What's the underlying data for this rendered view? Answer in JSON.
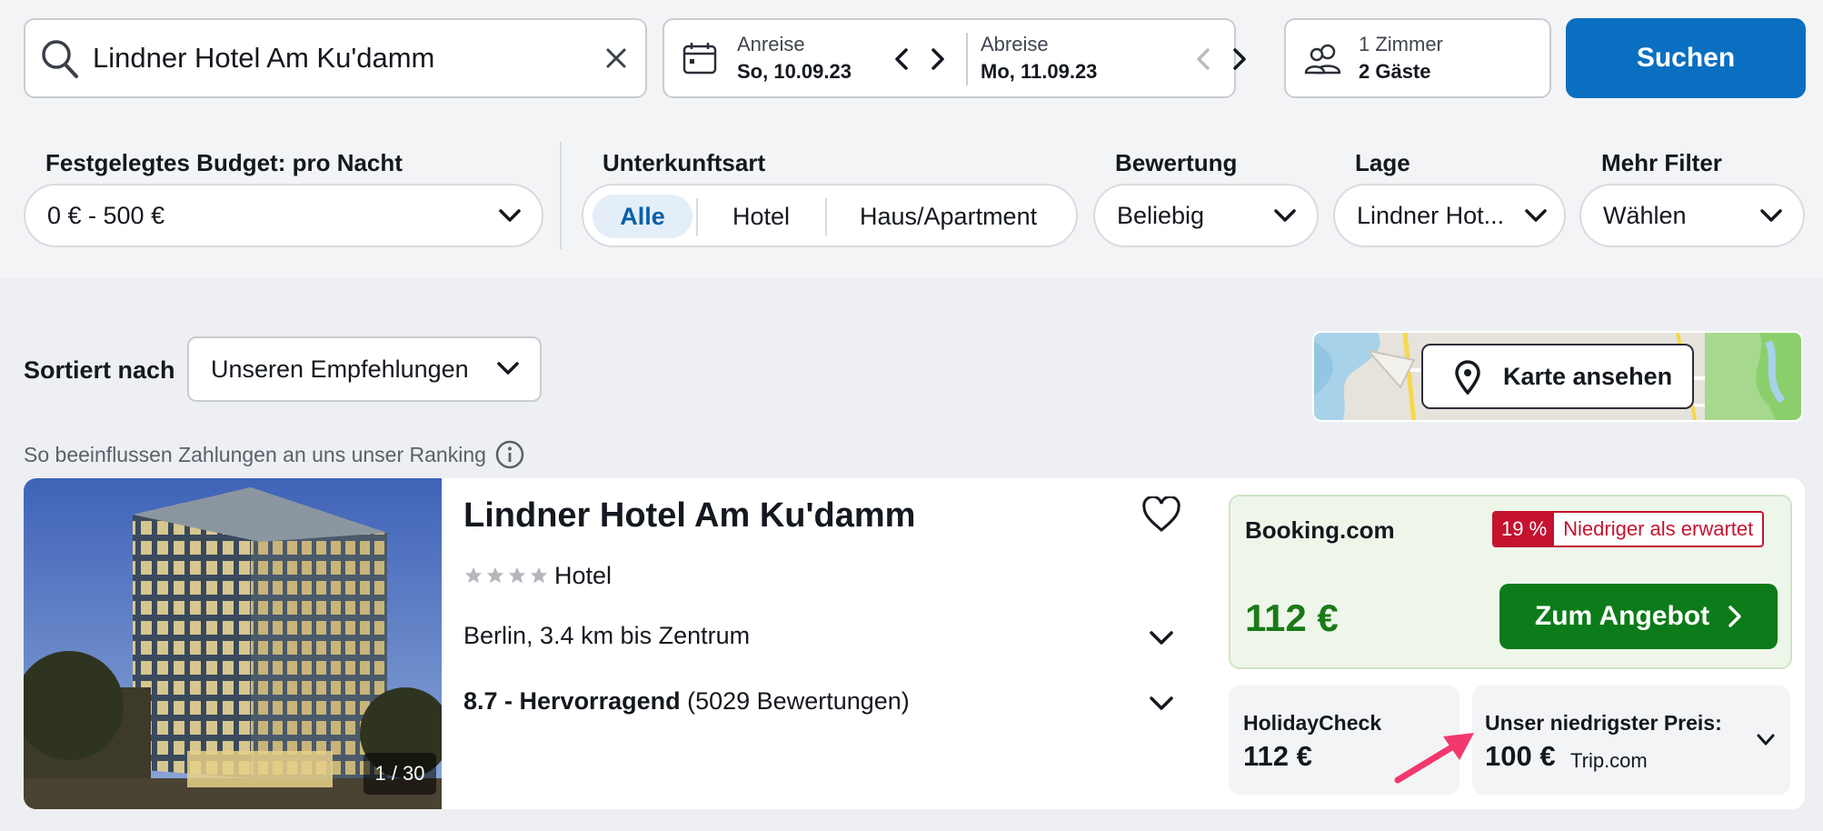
{
  "search": {
    "query": "Lindner Hotel Am Ku'damm",
    "checkin_label": "Anreise",
    "checkin_value": "So, 10.09.23",
    "checkout_label": "Abreise",
    "checkout_value": "Mo, 11.09.23",
    "rooms": "1 Zimmer",
    "guests": "2 Gäste",
    "submit_label": "Suchen"
  },
  "filters": {
    "budget_label": "Festgelegtes Budget: pro Nacht",
    "budget_value": "0 € - 500 €",
    "type_label": "Unterkunftsart",
    "type_options": [
      "Alle",
      "Hotel",
      "Haus/Apartment"
    ],
    "type_selected": "Alle",
    "rating_label": "Bewertung",
    "rating_value": "Beliebig",
    "location_label": "Lage",
    "location_value": "Lindner Hot...",
    "more_label": "Mehr Filter",
    "more_value": "Wählen"
  },
  "sort": {
    "label": "Sortiert nach",
    "value": "Unseren Empfehlungen"
  },
  "map": {
    "button_label": "Karte ansehen"
  },
  "ranking_note": "So beeinflussen Zahlungen an uns unser Ranking",
  "result": {
    "title": "Lindner Hotel Am Ku'damm",
    "stars": 4,
    "type": "Hotel",
    "location": "Berlin, 3.4 km bis Zentrum",
    "rating_score": "8.7 - Hervorragend",
    "rating_count": "(5029 Bewertungen)",
    "image_counter": "1 / 30",
    "main_offer": {
      "provider": "Booking.com",
      "deal_percent": "19 %",
      "deal_text": "Niedriger als erwartet",
      "price": "112 €",
      "cta_label": "Zum Angebot"
    },
    "alt_offer": {
      "provider": "HolidayCheck",
      "price": "112 €"
    },
    "lowest_offer": {
      "label": "Unser niedrigster Preis:",
      "price": "100 €",
      "provider": "Trip.com"
    }
  },
  "colors": {
    "primary": "#0a6fc1",
    "deal_green": "#0c7b19",
    "price_green": "#1a7a17",
    "badge_red": "#c4122f",
    "annotation_arrow": "#f2386e"
  }
}
